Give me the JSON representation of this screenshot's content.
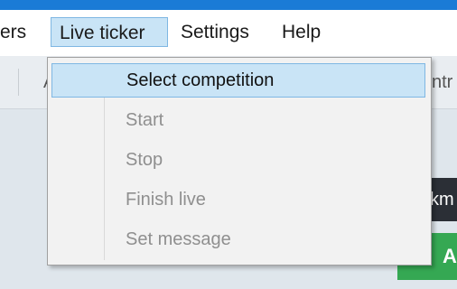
{
  "menubar": {
    "items": [
      {
        "label": "ers"
      },
      {
        "label": "Live ticker"
      },
      {
        "label": "Settings"
      },
      {
        "label": "Help"
      }
    ]
  },
  "toolbar": {
    "left_fragment": "A",
    "right_fragment": "ntr"
  },
  "background": {
    "dark_chip_text": "km",
    "green_button_text": "A"
  },
  "dropdown": {
    "items": [
      {
        "label": "Select competition",
        "state": "hover"
      },
      {
        "label": "Start",
        "state": "disabled"
      },
      {
        "label": "Stop",
        "state": "disabled"
      },
      {
        "label": "Finish live",
        "state": "disabled"
      },
      {
        "label": "Set message",
        "state": "disabled"
      }
    ]
  },
  "colors": {
    "accent": "#1a7bd6",
    "highlight": "#c9e4f6",
    "highlight_border": "#7fb7e3",
    "disabled_text": "#8f8f8f",
    "green": "#35a853"
  }
}
